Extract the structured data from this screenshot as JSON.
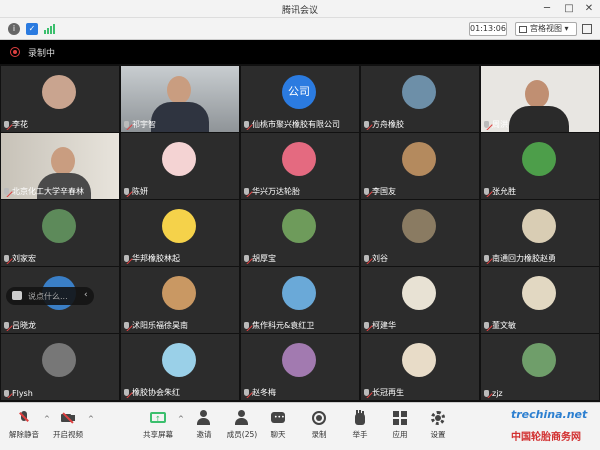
{
  "window": {
    "title": "腾讯会议"
  },
  "toolbar_top": {
    "timer": "01:13:06",
    "view_label": "宫格视图"
  },
  "recording": {
    "label": "录制中"
  },
  "participants": [
    {
      "name": "李花",
      "kind": "avatar",
      "color": "#c9a48f"
    },
    {
      "name": "祁宇智",
      "kind": "video",
      "active": true
    },
    {
      "name": "仙桃市聚兴橡胶有限公司",
      "kind": "logo",
      "logo_text": "公司",
      "color": "#2b7be0"
    },
    {
      "name": "方舟橡胶",
      "kind": "avatar",
      "color": "#6d8fa8"
    },
    {
      "name": "周洪",
      "kind": "video2"
    },
    {
      "name": "北京化工大学辛春林",
      "kind": "video3"
    },
    {
      "name": "陈妍",
      "kind": "avatar",
      "color": "#f4d3d3"
    },
    {
      "name": "华兴万达轮胎",
      "kind": "avatar",
      "color": "#e46a80"
    },
    {
      "name": "李国友",
      "kind": "avatar",
      "color": "#b48a5e"
    },
    {
      "name": "张允胜",
      "kind": "avatar",
      "color": "#4d9e4a"
    },
    {
      "name": "刘家宏",
      "kind": "avatar",
      "color": "#5d8a5a"
    },
    {
      "name": "华邦橡胶林起",
      "kind": "avatar",
      "color": "#f5d24a"
    },
    {
      "name": "胡厚宝",
      "kind": "avatar",
      "color": "#6e9b5b"
    },
    {
      "name": "刘谷",
      "kind": "avatar",
      "color": "#8a7b62"
    },
    {
      "name": "南通回力橡胶赵勇",
      "kind": "avatar",
      "color": "#d9cdb4"
    },
    {
      "name": "吕晓龙",
      "kind": "avatar",
      "color": "#3a7fc7"
    },
    {
      "name": "沭阳乐福徐昊南",
      "kind": "avatar",
      "color": "#c99863"
    },
    {
      "name": "焦作科元&袁红卫",
      "kind": "avatar",
      "color": "#6aa9d8"
    },
    {
      "name": "柯建华",
      "kind": "avatar",
      "color": "#e8e2d4"
    },
    {
      "name": "董文敏",
      "kind": "avatar",
      "color": "#e2d8c2"
    },
    {
      "name": "Flysh",
      "kind": "avatar",
      "color": "#777777"
    },
    {
      "name": "橡胶协会朱红",
      "kind": "avatar",
      "color": "#9ad0e8"
    },
    {
      "name": "赵冬梅",
      "kind": "avatar",
      "color": "#a27ab0"
    },
    {
      "name": "长冠再生",
      "kind": "avatar",
      "color": "#e8dcc8"
    },
    {
      "name": "zjz",
      "kind": "avatar",
      "color": "#6f9e6a"
    }
  ],
  "chat_input": {
    "placeholder": "说点什么..."
  },
  "bottom_bar": {
    "mute": "解除静音",
    "video": "开启视频",
    "share": "共享屏幕",
    "invite": "邀请",
    "members": "成员(25)",
    "chat": "聊天",
    "record": "录制",
    "raise_hand": "举手",
    "apps": "应用",
    "settings": "设置"
  },
  "watermark": {
    "site": "trechina.net",
    "cn": "中国轮胎商务网"
  }
}
